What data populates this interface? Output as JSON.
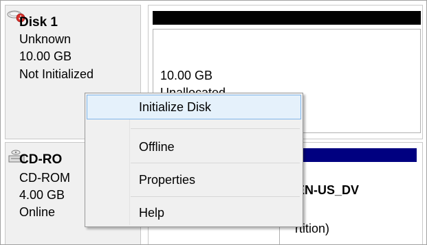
{
  "disks": [
    {
      "title": "Disk 1",
      "icon": "disk-error-icon",
      "type": "Unknown",
      "size": "10.00 GB",
      "status": "Not Initialized",
      "volume": {
        "size": "10.00 GB",
        "state": "Unallocated",
        "header_color": "#000000"
      }
    },
    {
      "title": "CD-RO",
      "icon": "cdrom-icon",
      "type": "CD-ROM",
      "size": "4.00 GB",
      "status": "Online",
      "volume": {
        "name": "EN-US_DV",
        "detail": "rtition)",
        "header_color": "#000080"
      }
    }
  ],
  "context_menu": {
    "items": [
      {
        "label": "Initialize Disk",
        "highlighted": true
      },
      {
        "label": "Offline",
        "highlighted": false
      },
      {
        "label": "Properties",
        "highlighted": false
      },
      {
        "label": "Help",
        "highlighted": false
      }
    ],
    "highlight_fill": "#e5f1fb",
    "highlight_border": "#7eb4ea"
  }
}
